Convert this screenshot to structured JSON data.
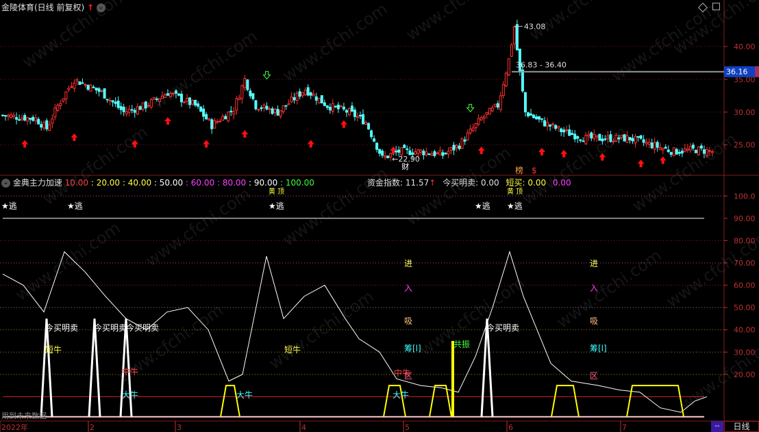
{
  "main_header": {
    "title": "金陵体育(日线 前复权)",
    "up_arrow": "↑",
    "dropdown": "⌄"
  },
  "main_chart": {
    "ylim": [
      21,
      45
    ],
    "ticks": [
      "40.00",
      "35.00",
      "30.00",
      "25.00"
    ],
    "tick_values": [
      40,
      35,
      30,
      25
    ],
    "current_price": "36.16",
    "high_label": "43.08",
    "low_label": "22.90",
    "range_label": "36.83 - 36.40",
    "marks": {
      "cai": "财",
      "bang": "榜",
      "dollar": "$"
    }
  },
  "indicator_header": {
    "name": "金典主力加速",
    "levels": [
      {
        "text": "10.00",
        "color": "#ff4040"
      },
      {
        "text": "20.00",
        "color": "#ffff40"
      },
      {
        "text": "40.00",
        "color": "#ffff40"
      },
      {
        "text": "50.00",
        "color": "#ffffff"
      },
      {
        "text": "60.00",
        "color": "#ff40ff"
      },
      {
        "text": "80.00",
        "color": "#ff40ff"
      },
      {
        "text": "90.00",
        "color": "#ffffff"
      },
      {
        "text": "100.00",
        "color": "#40ff40"
      }
    ],
    "fund_index": "资金指数: 11.57",
    "fund_arrow": "↑",
    "today_trade": "今买明卖: 0.00",
    "short_buy": "短买: 0.00",
    "magenta_val": "0.00"
  },
  "indicator_chart": {
    "ylim": [
      0,
      105
    ],
    "ticks": [
      "100.0",
      "90.00",
      "80.00",
      "70.00",
      "60.00",
      "50.00",
      "40.00",
      "30.00",
      "20.00"
    ],
    "tick_values": [
      100,
      90,
      80,
      70,
      60,
      50,
      40,
      30,
      20
    ],
    "labels": {
      "escape": "★逃",
      "today_trade": "今买明卖",
      "short_bull": "短牛",
      "mid_bull": "中牛",
      "big_bull": "大牛",
      "start": "共振",
      "jin": "进",
      "ru": "入",
      "xi": "吸",
      "chou": "筹[l]",
      "qu": "区",
      "future": "用到未来数据",
      "yellow_tag": "黄 顶"
    }
  },
  "x_axis": {
    "labels": [
      "2022年",
      "2",
      "3",
      "4",
      "5",
      "6",
      "7"
    ],
    "period_button": "日线",
    "mini": "--"
  },
  "watermark": "www.cfchi.com",
  "colors": {
    "up": "#ff3232",
    "down": "#54ffff",
    "grid": "#7a1a1a",
    "axis_text": "#c03030",
    "line": "#ffffff",
    "yellow": "#ffff00"
  }
}
